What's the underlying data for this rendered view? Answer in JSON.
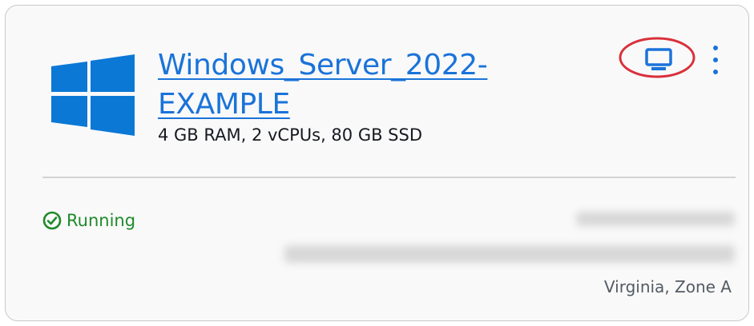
{
  "instance": {
    "name": "Windows_Server_2022-EXAMPLE",
    "specs": "4 GB RAM, 2 vCPUs, 80 GB SSD",
    "status": "Running",
    "region": "Virginia, Zone A"
  },
  "icons": {
    "os_logo": "windows-logo",
    "connect": "monitor-icon",
    "menu": "more-vertical-icon",
    "status": "check-circle-icon"
  },
  "colors": {
    "link": "#1a73d9",
    "status_running": "#1e8a2a",
    "highlight_ring": "#d9303a",
    "windows_blue": "#0b78d6"
  }
}
